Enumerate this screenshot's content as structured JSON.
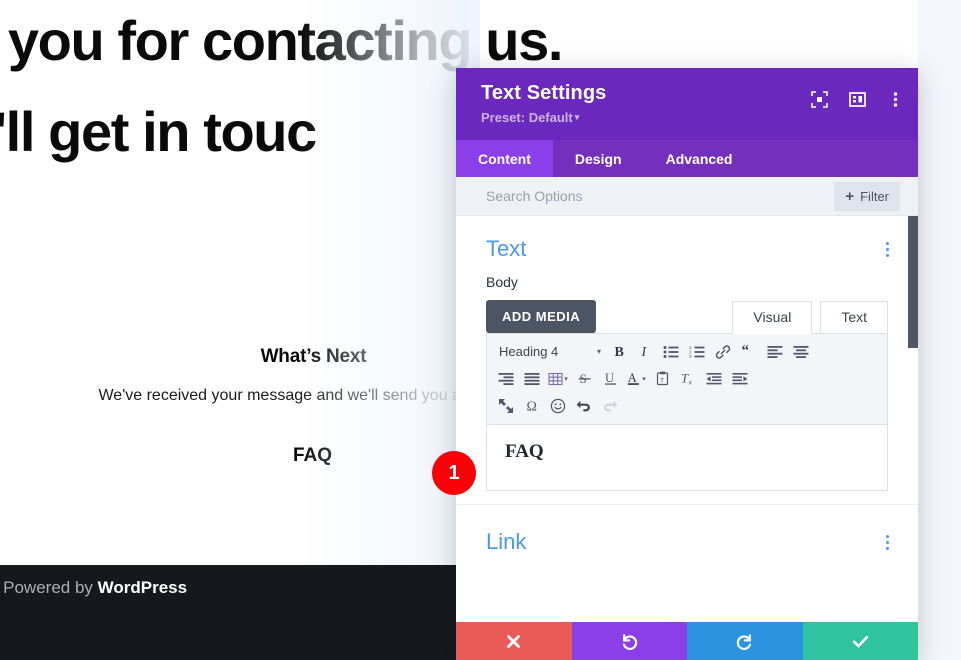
{
  "background_page": {
    "hero_line1": "k you for contacting us.",
    "hero_line2": "e'll get in touc",
    "whats_next_heading": "What’s Next",
    "whats_next_body": "We've received your message and we'll send you an email w",
    "faq_heading": "FAQ",
    "footer_prefix": "| Powered by ",
    "footer_brand": "WordPress"
  },
  "modal": {
    "title": "Text Settings",
    "preset_label": "Preset: Default",
    "preset_caret": "▾",
    "header_icons": [
      {
        "name": "focus-target-icon",
        "title": "Focus"
      },
      {
        "name": "layout-panel-icon",
        "title": "Layout"
      },
      {
        "name": "kebab-menu-icon",
        "title": "More options"
      }
    ],
    "tabs": [
      {
        "label": "Content",
        "active": true
      },
      {
        "label": "Design",
        "active": false
      },
      {
        "label": "Advanced",
        "active": false
      }
    ],
    "search": {
      "placeholder": "Search Options",
      "value": ""
    },
    "filter_button": {
      "plus": "+",
      "label": "Filter"
    },
    "text_section": {
      "title": "Text",
      "field_label": "Body",
      "add_media_label": "ADD MEDIA",
      "editor_tabs": [
        {
          "label": "Visual",
          "active": true
        },
        {
          "label": "Text",
          "active": false
        }
      ],
      "format_select": {
        "value": "Heading 4",
        "caret": "▾"
      },
      "toolbar_row1": [
        {
          "name": "bold-icon",
          "title": "Bold"
        },
        {
          "name": "italic-icon",
          "title": "Italic"
        },
        {
          "name": "bulleted-list-icon",
          "title": "Bulleted list"
        },
        {
          "name": "numbered-list-icon",
          "title": "Numbered list"
        },
        {
          "name": "link-icon",
          "title": "Insert link"
        },
        {
          "name": "blockquote-icon",
          "title": "Blockquote"
        },
        {
          "name": "align-left-icon",
          "title": "Align left"
        },
        {
          "name": "align-center-icon",
          "title": "Align center"
        }
      ],
      "toolbar_row2": [
        {
          "name": "align-right-icon",
          "title": "Align right"
        },
        {
          "name": "align-justify-icon",
          "title": "Justify"
        },
        {
          "name": "table-icon",
          "title": "Table"
        },
        {
          "name": "strikethrough-icon",
          "title": "Strikethrough"
        },
        {
          "name": "underline-icon",
          "title": "Underline"
        },
        {
          "name": "text-color-icon",
          "title": "Text color"
        },
        {
          "name": "paste-as-text-icon",
          "title": "Paste as text"
        },
        {
          "name": "clear-formatting-icon",
          "title": "Clear formatting"
        },
        {
          "name": "outdent-icon",
          "title": "Decrease indent"
        },
        {
          "name": "indent-icon",
          "title": "Increase indent"
        }
      ],
      "toolbar_row3": [
        {
          "name": "fullscreen-icon",
          "title": "Fullscreen"
        },
        {
          "name": "special-character-icon",
          "title": "Special character"
        },
        {
          "name": "emoji-icon",
          "title": "Emoji"
        },
        {
          "name": "undo-icon",
          "title": "Undo"
        },
        {
          "name": "redo-icon",
          "title": "Redo"
        }
      ],
      "editor_content": "FAQ"
    },
    "link_section": {
      "title": "Link"
    },
    "actions": [
      {
        "name": "cancel-button",
        "icon": "close-icon",
        "color": "#ea5a57"
      },
      {
        "name": "undo-button",
        "icon": "undo-icon",
        "color": "#8b3fe8"
      },
      {
        "name": "redo-button",
        "icon": "redo-icon",
        "color": "#2a93e0"
      },
      {
        "name": "save-button",
        "icon": "checkmark-icon",
        "color": "#2fc49e"
      }
    ]
  },
  "annotation": {
    "step_number": "1"
  }
}
